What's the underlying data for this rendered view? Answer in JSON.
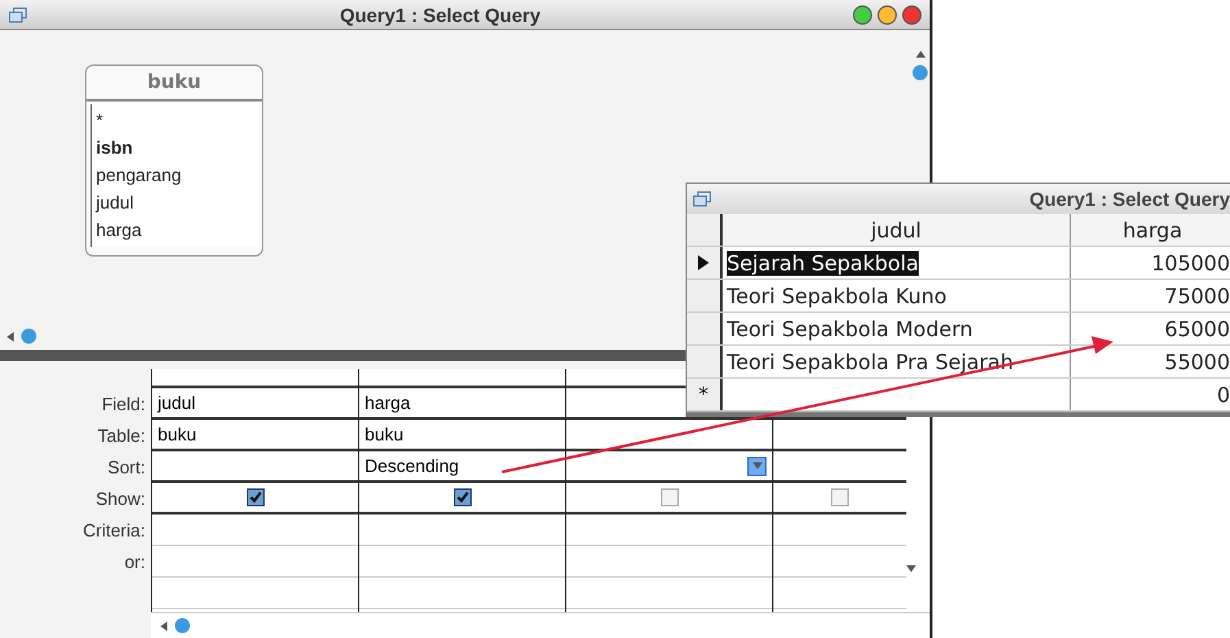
{
  "design_window": {
    "title": "Query1 : Select Query",
    "table_box": {
      "name": "buku",
      "fields": [
        {
          "label": "*",
          "key": false
        },
        {
          "label": "isbn",
          "key": true
        },
        {
          "label": "pengarang",
          "key": false
        },
        {
          "label": "judul",
          "key": false
        },
        {
          "label": "harga",
          "key": false
        }
      ]
    },
    "row_labels": [
      "Field:",
      "Table:",
      "Sort:",
      "Show:",
      "Criteria:",
      "or:"
    ],
    "columns": [
      {
        "field": "judul",
        "table": "buku",
        "show": true,
        "active": false
      },
      {
        "field": "harga",
        "table": "buku",
        "sort": "Descending",
        "show": true,
        "active": false
      },
      {
        "show": false,
        "active": true
      },
      {
        "show": false,
        "active": false
      }
    ]
  },
  "datasheet_window": {
    "title": "Query1 : Select Query",
    "columns": [
      "judul",
      "harga"
    ],
    "rows": [
      {
        "judul": "Sejarah Sepakbola",
        "harga": "105000",
        "selected": true
      },
      {
        "judul": "Teori Sepakbola Kuno",
        "harga": "75000",
        "selected": false
      },
      {
        "judul": "Teori Sepakbola Modern",
        "harga": "65000",
        "selected": false
      },
      {
        "judul": "Teori Sepakbola Pra Sejarah",
        "harga": "55000",
        "selected": false
      }
    ],
    "new_row": {
      "marker": "*",
      "harga": "0"
    }
  }
}
